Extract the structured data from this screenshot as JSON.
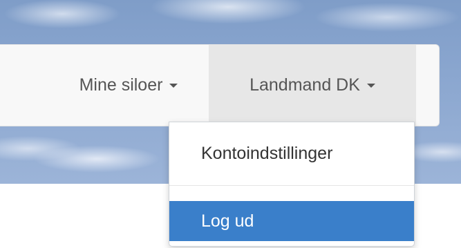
{
  "navbar": {
    "items": [
      {
        "label": "Mine siloer",
        "has_dropdown": true
      },
      {
        "label": "Landmand DK",
        "has_dropdown": true,
        "active": true
      }
    ]
  },
  "user_menu": {
    "items": [
      {
        "label": "Kontoindstillinger"
      },
      {
        "label": "Log ud",
        "highlighted": true
      }
    ]
  },
  "colors": {
    "navbar_background": "#f8f8f8",
    "active_item_background": "#e7e7e7",
    "highlight": "#3a7fca",
    "text": "#555555",
    "sky": "#8aa6cf"
  },
  "icons": {
    "caret": "chevron-down-icon"
  }
}
